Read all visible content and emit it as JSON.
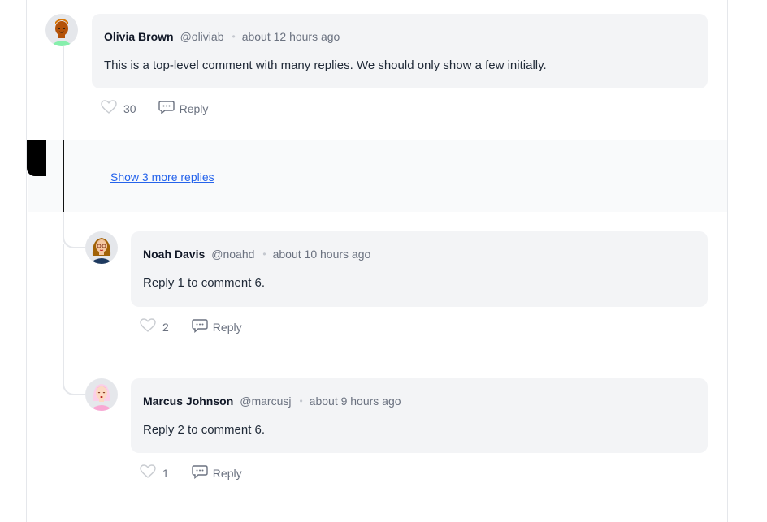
{
  "comments": [
    {
      "author": "Olivia Brown",
      "handle": "@oliviab",
      "time": "about 12 hours ago",
      "text": "This is a top-level comment with many replies. We should only show a few initially.",
      "likes": "30",
      "reply_label": "Reply"
    }
  ],
  "show_more": {
    "label": "Show 3 more replies"
  },
  "replies": [
    {
      "author": "Noah Davis",
      "handle": "@noahd",
      "time": "about 10 hours ago",
      "text": "Reply 1 to comment 6.",
      "likes": "2",
      "reply_label": "Reply"
    },
    {
      "author": "Marcus Johnson",
      "handle": "@marcusj",
      "time": "about 9 hours ago",
      "text": "Reply 2 to comment 6.",
      "likes": "1",
      "reply_label": "Reply"
    }
  ],
  "separator": "•",
  "icons": {
    "like": "heart-icon",
    "reply": "speech-bubble-icon"
  },
  "colors": {
    "link": "#2563eb",
    "bubble": "#f3f4f6",
    "muted": "#6b7280"
  }
}
